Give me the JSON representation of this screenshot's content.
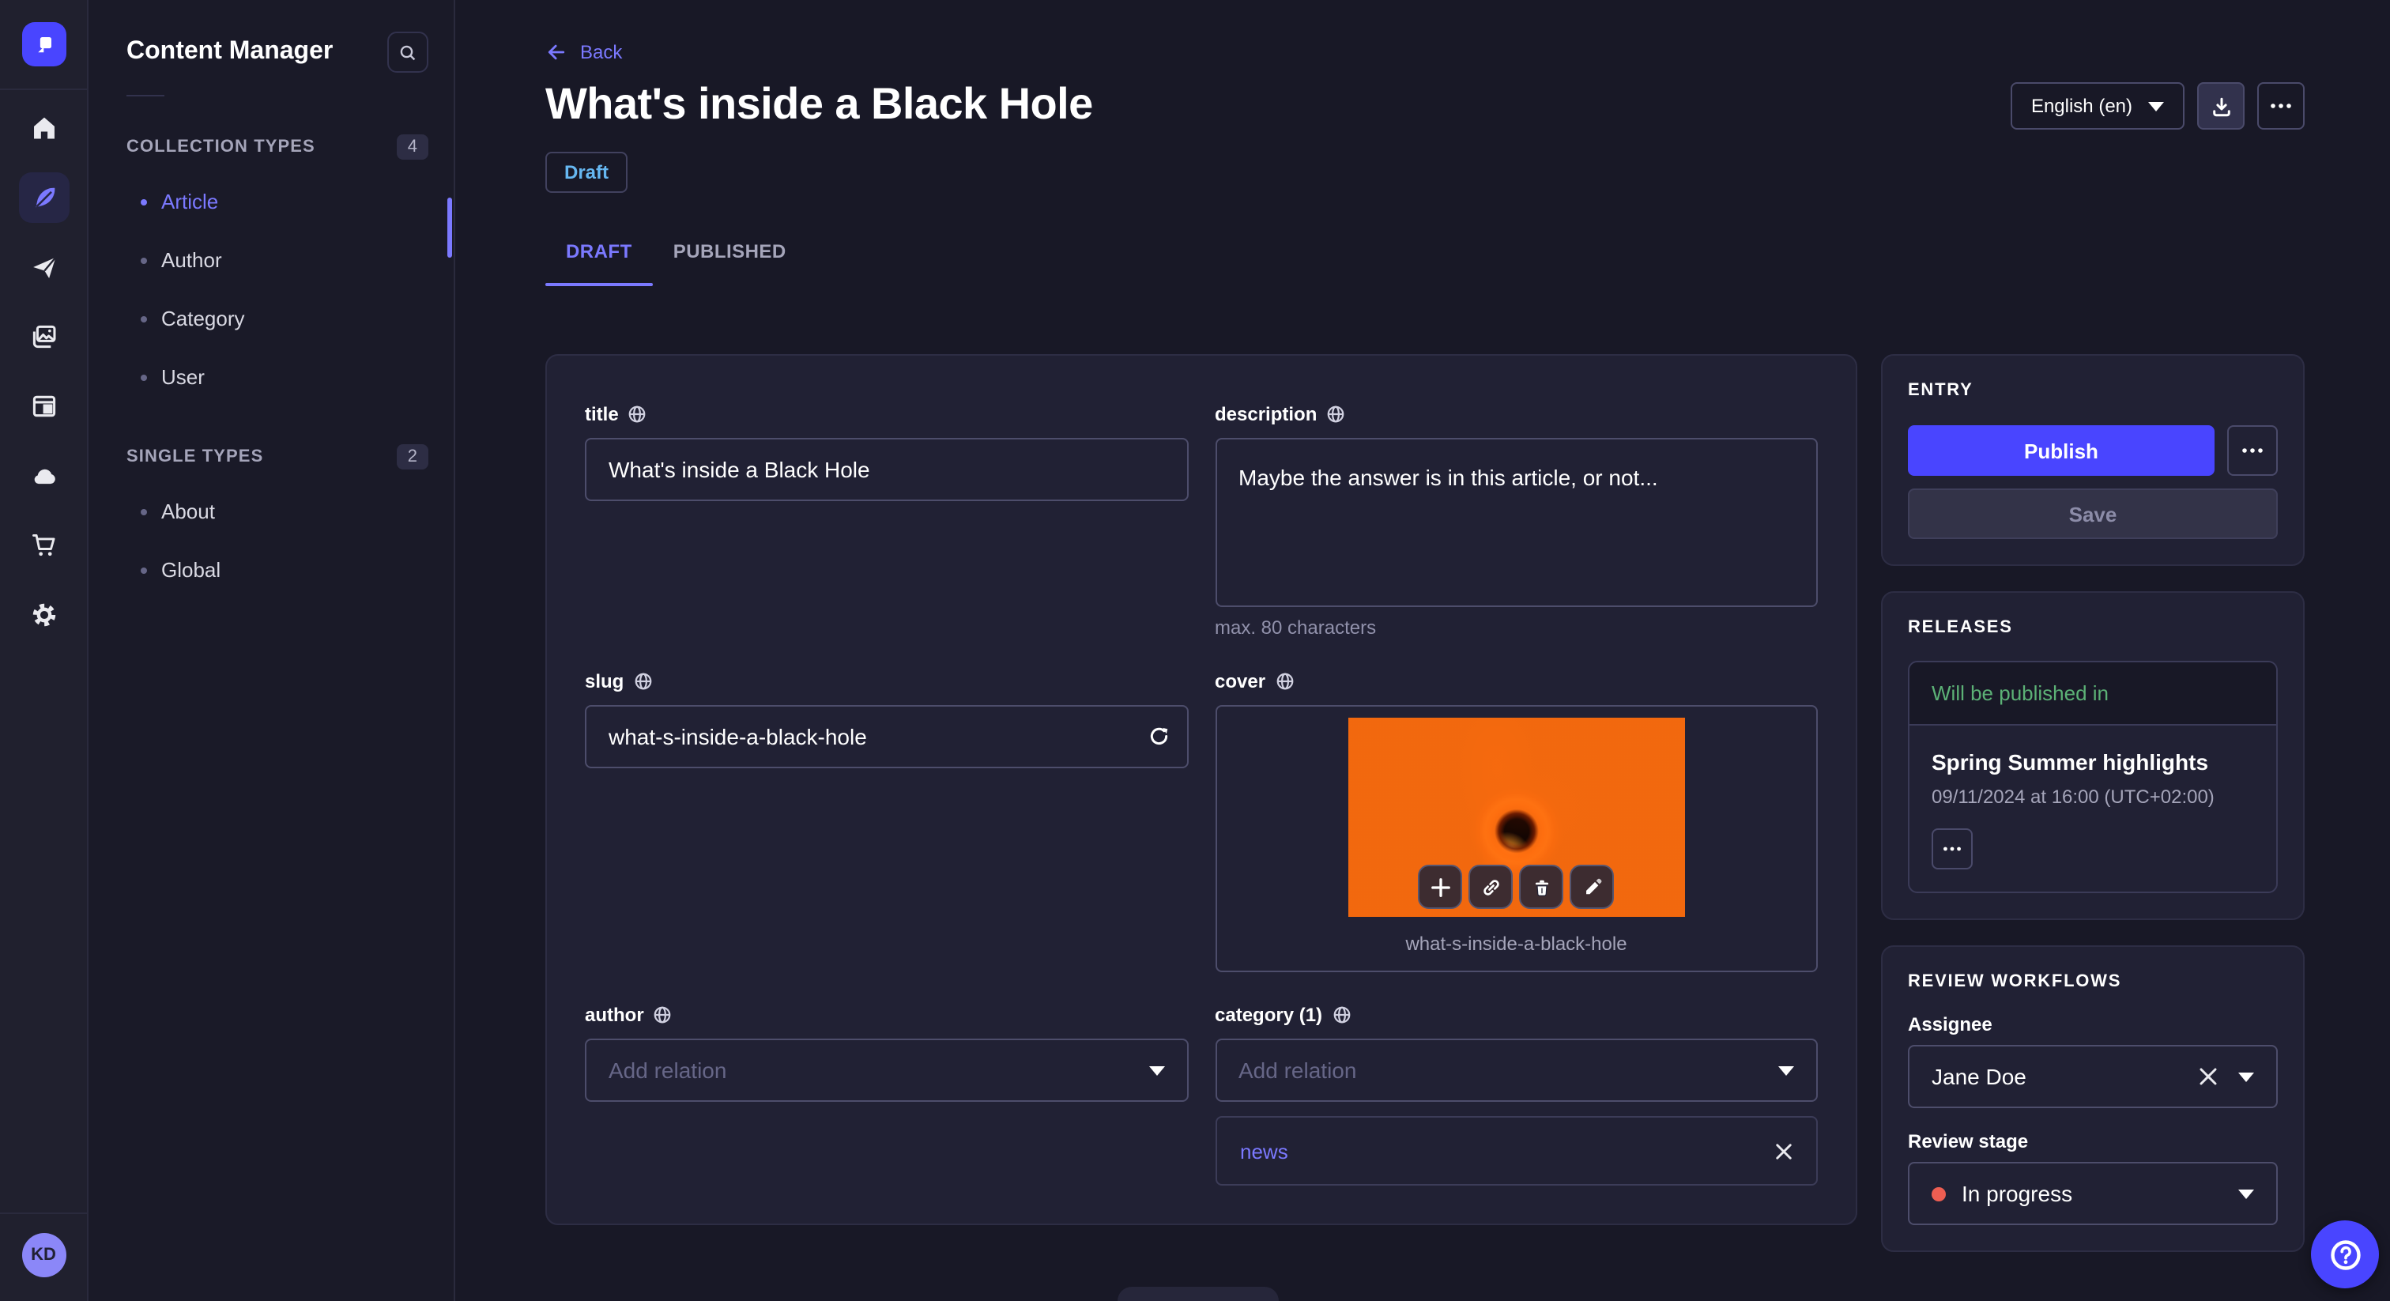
{
  "colors": {
    "accent": "#4945ff",
    "link_purple": "#7b79ff",
    "draft_blue": "#66b7f1",
    "success_green": "#5cb176",
    "stage_red": "#ee5e52"
  },
  "subnav": {
    "title": "Content Manager",
    "sections": [
      {
        "label": "COLLECTION TYPES",
        "badge": "4",
        "items": [
          {
            "label": "Article",
            "active": true
          },
          {
            "label": "Author",
            "active": false
          },
          {
            "label": "Category",
            "active": false
          },
          {
            "label": "User",
            "active": false
          }
        ]
      },
      {
        "label": "SINGLE TYPES",
        "badge": "2",
        "items": [
          {
            "label": "About",
            "active": false
          },
          {
            "label": "Global",
            "active": false
          }
        ]
      }
    ]
  },
  "header": {
    "back": "Back",
    "title": "What's inside a Black Hole",
    "status": "Draft",
    "locale": "English (en)",
    "tabs": [
      {
        "label": "DRAFT",
        "active": true
      },
      {
        "label": "PUBLISHED",
        "active": false
      }
    ]
  },
  "form": {
    "title": {
      "label": "title",
      "value": "What's inside a Black Hole"
    },
    "description": {
      "label": "description",
      "value": "Maybe the answer is in this article, or not...",
      "hint": "max. 80 characters"
    },
    "slug": {
      "label": "slug",
      "value": "what-s-inside-a-black-hole"
    },
    "cover": {
      "label": "cover",
      "caption": "what-s-inside-a-black-hole"
    },
    "author": {
      "label": "author",
      "placeholder": "Add relation"
    },
    "category": {
      "label": "category (1)",
      "placeholder": "Add relation",
      "relations": [
        {
          "label": "news"
        }
      ]
    }
  },
  "entry": {
    "title": "ENTRY",
    "publish": "Publish",
    "save": "Save"
  },
  "releases": {
    "title": "RELEASES",
    "card_header": "Will be published in",
    "name": "Spring Summer highlights",
    "date": "09/11/2024 at 16:00 (UTC+02:00)"
  },
  "review": {
    "title": "REVIEW WORKFLOWS",
    "assignee_label": "Assignee",
    "assignee": "Jane Doe",
    "stage_label": "Review stage",
    "stage": "In progress"
  },
  "user": {
    "initials": "KD"
  }
}
